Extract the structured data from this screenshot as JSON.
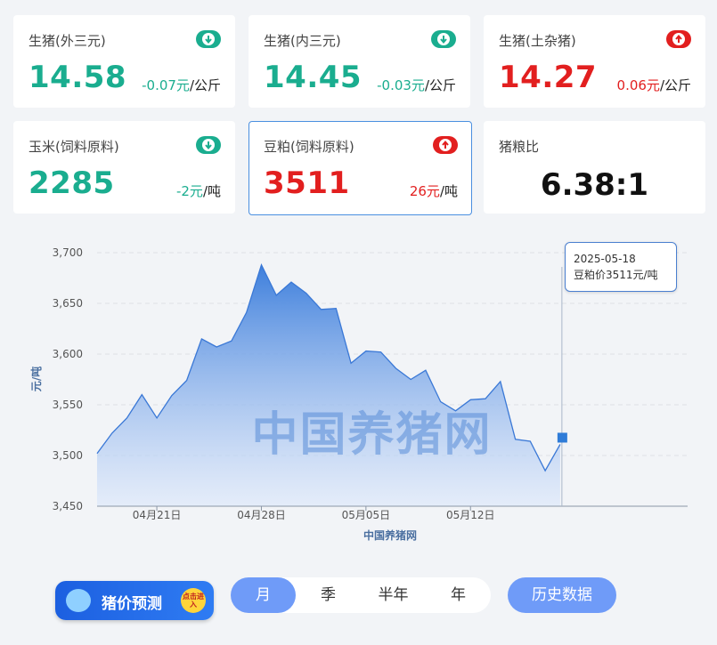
{
  "cards": [
    {
      "title": "生猪(外三元)",
      "value": "14.58",
      "change": "-0.07元",
      "unit": "/公斤",
      "dir": "down"
    },
    {
      "title": "生猪(内三元)",
      "value": "14.45",
      "change": "-0.03元",
      "unit": "/公斤",
      "dir": "down"
    },
    {
      "title": "生猪(土杂猪)",
      "value": "14.27",
      "change": "0.06元",
      "unit": "/公斤",
      "dir": "up"
    },
    {
      "title": "玉米(饲料原料)",
      "value": "2285",
      "change": "-2元",
      "unit": "/吨",
      "dir": "down"
    },
    {
      "title": "豆粕(饲料原料)",
      "value": "3511",
      "change": "26元",
      "unit": "/吨",
      "dir": "up"
    }
  ],
  "ratio_card": {
    "title": "猪粮比",
    "value": "6.38:1"
  },
  "colors": {
    "down": "#1aad8f",
    "up": "#e21f1f",
    "accent": "#6f9bf8",
    "line": "#3a78d6"
  },
  "chart_data": {
    "type": "area",
    "title": "",
    "xlabel": "中国养猪网",
    "ylabel": "元/吨",
    "ylim": [
      3450,
      3700
    ],
    "yticks": [
      3450,
      3500,
      3550,
      3600,
      3650,
      3700
    ],
    "ytick_labels": [
      "3,450",
      "3,500",
      "3,550",
      "3,600",
      "3,650",
      "3,700"
    ],
    "xtick_labels": [
      {
        "label": "04月21日",
        "index": 4
      },
      {
        "label": "04月28日",
        "index": 11
      },
      {
        "label": "05月05日",
        "index": 18
      },
      {
        "label": "05月12日",
        "index": 25
      }
    ],
    "x": [
      "2025-04-17",
      "2025-04-18",
      "2025-04-19",
      "2025-04-20",
      "2025-04-21",
      "2025-04-22",
      "2025-04-23",
      "2025-04-24",
      "2025-04-25",
      "2025-04-26",
      "2025-04-27",
      "2025-04-28",
      "2025-04-29",
      "2025-04-30",
      "2025-05-01",
      "2025-05-02",
      "2025-05-03",
      "2025-05-04",
      "2025-05-05",
      "2025-05-06",
      "2025-05-07",
      "2025-05-08",
      "2025-05-09",
      "2025-05-10",
      "2025-05-11",
      "2025-05-12",
      "2025-05-13",
      "2025-05-14",
      "2025-05-15",
      "2025-05-16",
      "2025-05-17",
      "2025-05-18"
    ],
    "values": [
      3502,
      3522,
      3537,
      3560,
      3537,
      3559,
      3574,
      3615,
      3607,
      3613,
      3641,
      3688,
      3658,
      3671,
      3660,
      3644,
      3645,
      3591,
      3603,
      3602,
      3586,
      3575,
      3584,
      3553,
      3544,
      3555,
      3556,
      3573,
      3516,
      3514,
      3485,
      3511
    ],
    "grid": true,
    "tooltip": {
      "date": "2025-05-18",
      "text": "豆粕价3511元/吨"
    },
    "watermark": "中国养猪网"
  },
  "controls": {
    "promo_label": "猪价预测",
    "promo_badge": "点击进入",
    "ranges": [
      "月",
      "季",
      "半年",
      "年"
    ],
    "active_range": "月",
    "history_label": "历史数据"
  }
}
